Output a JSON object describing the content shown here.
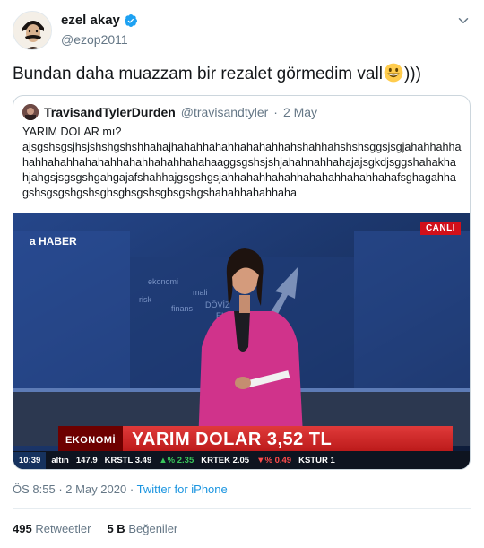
{
  "author": {
    "display_name": "ezel akay",
    "handle": "@ezop2011"
  },
  "tweet": {
    "text": "Bundan daha muazzam bir rezalet görmedim vall",
    "emoji": "grinning-face",
    "tail": ")))"
  },
  "quoted": {
    "display_name": "TravisandTylerDurden",
    "handle": "@travisandtyler",
    "sep": "·",
    "date": "2 May",
    "text_line1": "YARIM DOLAR mı?",
    "text_body": "ajsgshsgsjhsjshshgshshhahajhahahhahahhahahahhahshahhahshshsggsjsgjahahhahhahahhahahhahahahhahahhahahhahahaaggsgshsjshjahahnahhahajajsgkdjsggshahakhahjahgsjsgsgshgahgajafshahhajgsgshgsjahhahahhahahhahahahhahahhahafsghagahhagshsgsgshgshsghsghsgshsgbsgshgshahahhahahhaha",
    "media": {
      "channel_logo": "a HABER",
      "live_badge": "CANLI",
      "lower_third_tag": "EKONOMİ",
      "lower_third_text": "YARIM DOLAR 3,52 TL",
      "ticker": {
        "time": "10:39",
        "items": [
          "altın",
          "147.9",
          "KRSTL 3.49",
          "▲% 2.35",
          "KRTEK 2.05",
          "▼% 0.49",
          "KSTUR 1"
        ]
      }
    }
  },
  "meta": {
    "time": "ÖS 8:55",
    "sep": "·",
    "date": "2 May 2020",
    "source": "Twitter for iPhone"
  },
  "stats": {
    "retweets_count": "495",
    "retweets_label": "Retweetler",
    "likes_count": "5 B",
    "likes_label": "Beğeniler"
  },
  "colors": {
    "link": "#1b95e0",
    "verified": "#1da1f2",
    "muted": "#657786",
    "border": "#ccd6dd"
  }
}
